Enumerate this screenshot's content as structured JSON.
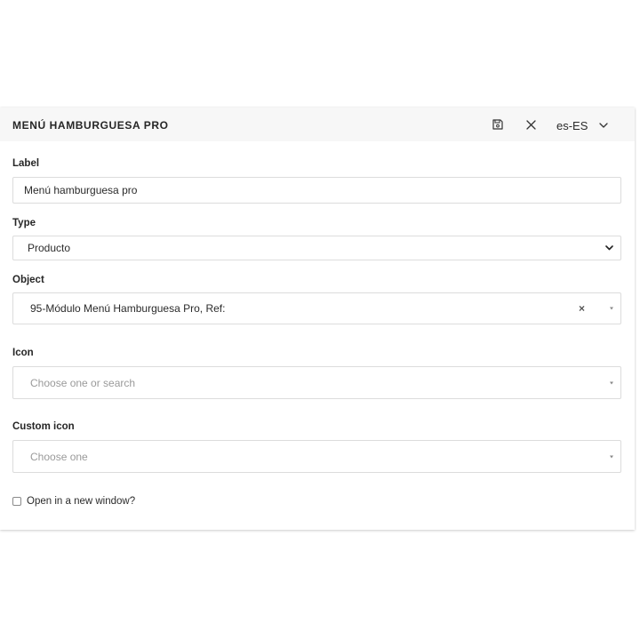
{
  "header": {
    "title": "MENÚ HAMBURGUESA PRO",
    "save_icon": "floppy-disk-icon",
    "close_icon": "close-icon",
    "language": "es-ES",
    "language_icon": "chevron-down-icon"
  },
  "form": {
    "label": {
      "label": "Label",
      "value": "Menú hamburguesa pro"
    },
    "type": {
      "label": "Type",
      "value": "Producto"
    },
    "object": {
      "label": "Object",
      "value": "95-Módulo Menú Hamburguesa Pro, Ref:",
      "clear": "×"
    },
    "icon": {
      "label": "Icon",
      "placeholder": "Choose one or search"
    },
    "custom_icon": {
      "label": "Custom icon",
      "placeholder": "Choose one"
    },
    "new_window": {
      "label": "Open in a new window?",
      "checked": false
    }
  }
}
